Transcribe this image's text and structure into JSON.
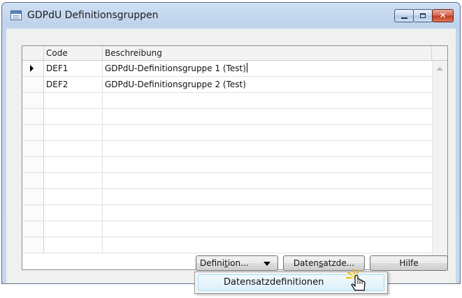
{
  "window": {
    "title": "GDPdU Definitionsgruppen",
    "controls": {
      "minimize": "minimize",
      "maximize": "maximize",
      "close": "✕"
    }
  },
  "grid": {
    "columns": [
      "Code",
      "Beschreibung"
    ],
    "rows": [
      {
        "code": "DEF1",
        "description": "GDPdU-Definitionsgruppe 1 (Test)",
        "current": true
      },
      {
        "code": "DEF2",
        "description": "GDPdU-Definitionsgruppe 2 (Test)",
        "current": false
      }
    ],
    "empty_rows": 10
  },
  "buttons": {
    "definition": {
      "pre": "Defini",
      "mnemonic": "t",
      "post": "ion...",
      "icon": "dropdown-arrow-icon"
    },
    "records": {
      "pre": "Daten",
      "mnemonic": "s",
      "post": "atzde..."
    },
    "help": "Hilfe"
  },
  "menu": {
    "items": [
      "Datensatzdefinitionen"
    ]
  },
  "colors": {
    "titlebar": "#c3d6ee",
    "close_button": "#c2381c",
    "menu_highlight": "#dcf0fb"
  }
}
